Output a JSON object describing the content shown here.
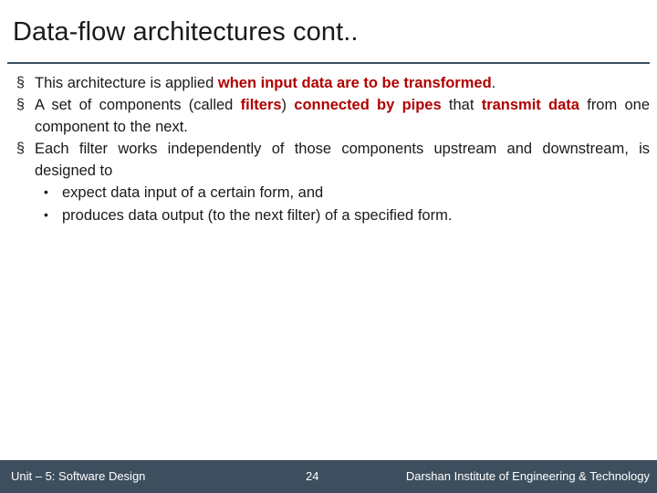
{
  "slide": {
    "title": "Data-flow architectures cont..",
    "bullets": [
      {
        "marker": "§",
        "segments": [
          {
            "text": "This architecture is applied ",
            "highlight": false
          },
          {
            "text": "when input data are to be transformed",
            "highlight": true
          },
          {
            "text": ".",
            "highlight": false
          }
        ]
      },
      {
        "marker": "§",
        "segments": [
          {
            "text": "A set of components (called ",
            "highlight": false
          },
          {
            "text": "filters",
            "highlight": true
          },
          {
            "text": ") ",
            "highlight": false
          },
          {
            "text": "connected by pipes",
            "highlight": true
          },
          {
            "text": " that ",
            "highlight": false
          },
          {
            "text": "transmit data",
            "highlight": true
          },
          {
            "text": " from one component to the next.",
            "highlight": false
          }
        ]
      },
      {
        "marker": "§",
        "segments": [
          {
            "text": "Each filter works independently of those components upstream and downstream, is designed to",
            "highlight": false
          }
        ]
      }
    ],
    "sub_bullets": [
      {
        "marker": "•",
        "text": "expect data input of a certain form, and"
      },
      {
        "marker": "•",
        "text": "produces data output (to the next filter) of a specified form."
      }
    ]
  },
  "footer": {
    "left": "Unit – 5: Software Design",
    "page": "24",
    "right": "Darshan Institute of Engineering & Technology"
  },
  "colors": {
    "accent": "#3d4f5e",
    "highlight": "#b00000",
    "text": "#1a1a1a"
  }
}
